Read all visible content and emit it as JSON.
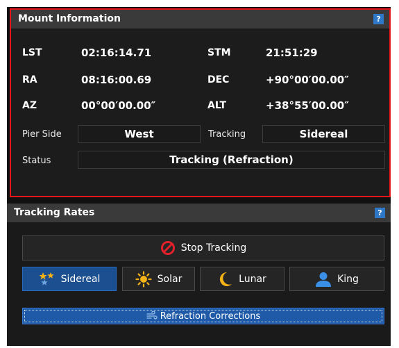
{
  "mount": {
    "title": "Mount Information",
    "help": "?",
    "lst_label": "LST",
    "lst_value": "02:16:14.71",
    "stm_label": "STM",
    "stm_value": "21:51:29",
    "ra_label": "RA",
    "ra_value": "08:16:00.69",
    "dec_label": "DEC",
    "dec_value": "+90°00′00.00″",
    "az_label": "AZ",
    "az_value": "00°00′00.00″",
    "alt_label": "ALT",
    "alt_value": "+38°55′00.00″",
    "pier_side_label": "Pier Side",
    "pier_side_value": "West",
    "tracking_label": "Tracking",
    "tracking_value": "Sidereal",
    "status_label": "Status",
    "status_value": "Tracking (Refraction)"
  },
  "rates": {
    "title": "Tracking Rates",
    "help": "?",
    "stop_label": "Stop Tracking",
    "sidereal_label": "Sidereal",
    "solar_label": "Solar",
    "lunar_label": "Lunar",
    "king_label": "King",
    "refraction_label": "Refraction Corrections",
    "selected_rate": "Sidereal"
  },
  "colors": {
    "highlight_border": "#e8141c",
    "active_button": "#1b4f8f",
    "refraction_button": "#1f5aa8",
    "help_icon": "#2f78c8",
    "sun_icon": "#f6b316",
    "moon_icon": "#f6b316",
    "king_icon": "#3a8fe6",
    "stop_icon": "#e0202a"
  }
}
